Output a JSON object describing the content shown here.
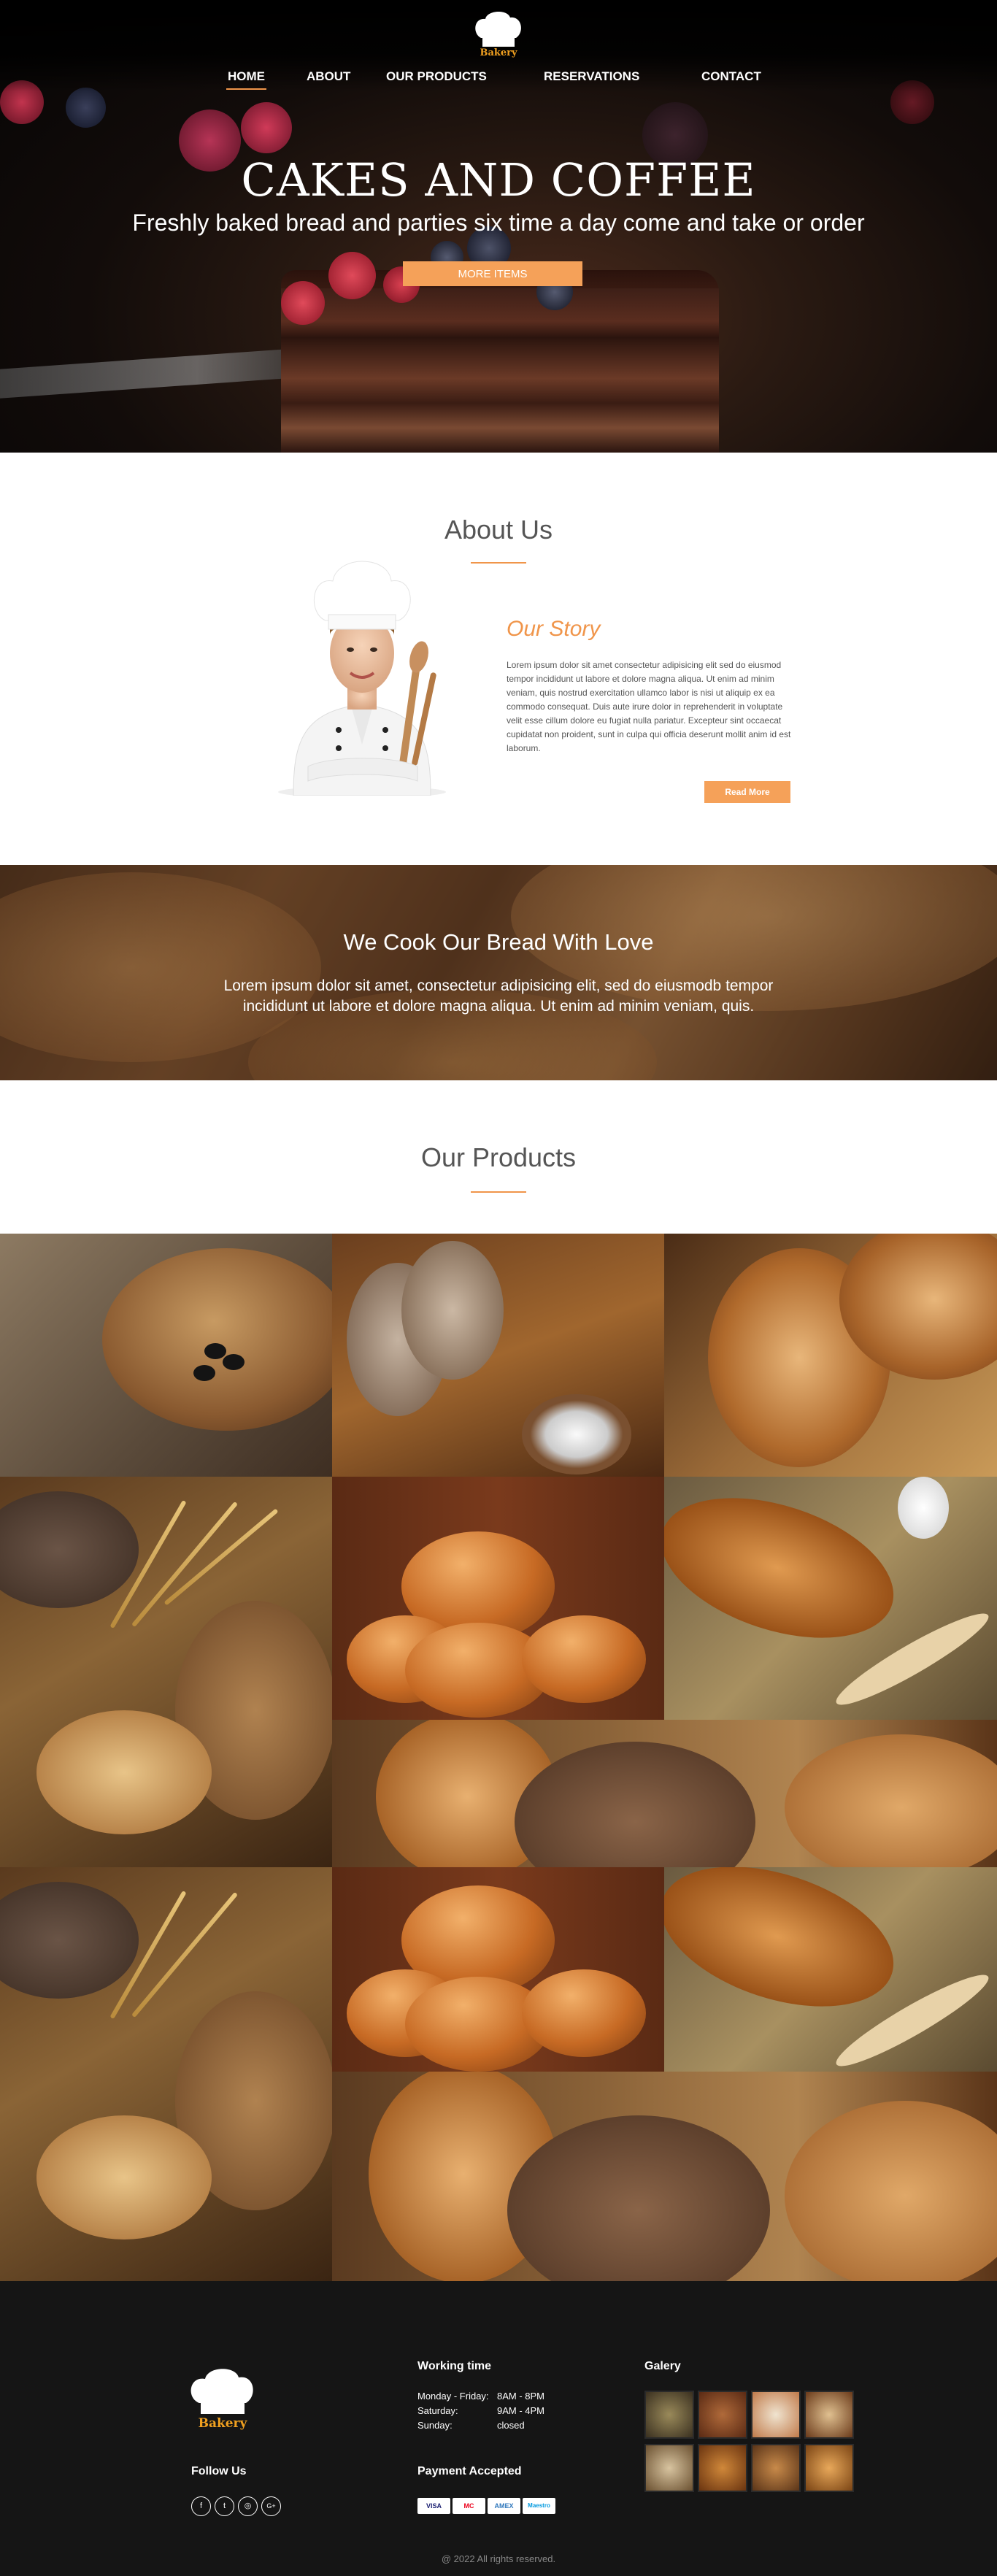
{
  "brand": {
    "logo_text": "Bakery",
    "accent_color": "#f0954a"
  },
  "nav": {
    "items": [
      {
        "label": "HOME",
        "active": true
      },
      {
        "label": "ABOUT",
        "active": false
      },
      {
        "label": "OUR PRODUCTS",
        "active": false
      },
      {
        "label": "RESERVATIONS",
        "active": false
      },
      {
        "label": "CONTACT",
        "active": false
      }
    ]
  },
  "hero": {
    "title": "CAKES AND COFFEE",
    "subtitle": "Freshly baked bread and parties six time a day come and take or order",
    "button_label": "MORE ITEMS"
  },
  "about": {
    "title": "About Us",
    "story_title": "Our Story",
    "story_text": "Lorem ipsum dolor sit amet consectetur adipisicing elit sed do eiusmod tempor incididunt ut labore et dolore magna aliqua. Ut enim ad minim veniam, quis nostrud exercitation ullamco labor is nisi ut aliquip ex ea commodo consequat. Duis aute irure dolor in reprehenderit in voluptate velit esse cillum dolore eu fugiat nulla pariatur. Excepteur sint occaecat cupidatat non proident, sunt in culpa qui officia deserunt mollit anim id est laborum.",
    "button_label": "Read More"
  },
  "love": {
    "title": "We Cook Our Bread With Love",
    "text": "Lorem ipsum dolor sit amet, consectetur adipisicing elit, sed do eiusmodb tempor incididunt ut labore et dolore magna aliqua. Ut enim ad minim veniam, quis."
  },
  "products": {
    "title": "Our Products"
  },
  "footer": {
    "logo_text": "Bakery",
    "follow_title": "Follow Us",
    "social": [
      {
        "icon": "facebook-icon",
        "glyph": "f"
      },
      {
        "icon": "twitter-icon",
        "glyph": "t"
      },
      {
        "icon": "instagram-icon",
        "glyph": "◎"
      },
      {
        "icon": "google-plus-icon",
        "glyph": "G+"
      }
    ],
    "working_title": "Working time",
    "hours": [
      {
        "day": "Monday - Friday:",
        "time": "8AM - 8PM"
      },
      {
        "day": "Saturday:",
        "time": "9AM - 4PM"
      },
      {
        "day": "Sunday:",
        "time": "closed"
      }
    ],
    "payment_title": "Payment Accepted",
    "payments": [
      {
        "name": "VISA",
        "color": "#1a1f71"
      },
      {
        "name": "MC",
        "color": "#eb001b"
      },
      {
        "name": "AMEX",
        "color": "#2e77bc"
      },
      {
        "name": "Maestro",
        "color": "#0099df"
      }
    ],
    "gallery_title": "Galery",
    "copyright": "@ 2022 All rights reserved."
  }
}
